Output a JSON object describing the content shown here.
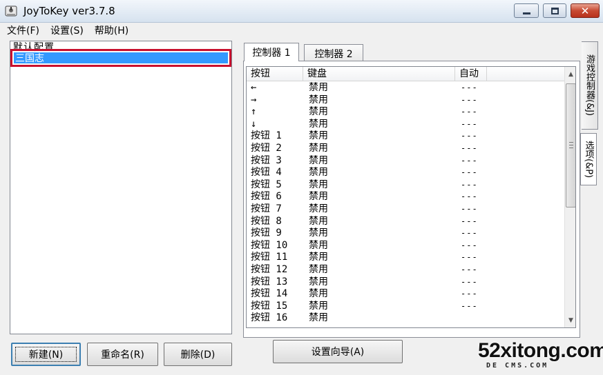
{
  "window": {
    "title": "JoyToKey ver3.7.8",
    "min_icon": "minimize-icon",
    "max_icon": "maximize-icon",
    "close_icon": "close-icon",
    "close_glyph": "✕"
  },
  "menu": {
    "file": "文件(F)",
    "settings": "设置(S)",
    "help": "帮助(H)"
  },
  "profiles": {
    "items": [
      "默认配置",
      "三国志"
    ],
    "selected": "三国志",
    "highlight_color": "#3399ff",
    "annotation_color": "#c8102e"
  },
  "buttons": {
    "new": "新建(N)",
    "rename": "重命名(R)",
    "delete": "删除(D)",
    "wizard": "设置向导(A)"
  },
  "tabs": {
    "controller1": "控制器 1",
    "controller2": "控制器 2"
  },
  "side_tabs": {
    "game_controller": "游戏控制器(&J)",
    "options": "选项(&P)"
  },
  "table": {
    "headers": [
      "按钮",
      "键盘",
      "自动"
    ],
    "rows": [
      {
        "button": "←",
        "icon": "arrow-left-icon",
        "key": "禁用",
        "auto": "---"
      },
      {
        "button": "→",
        "icon": "arrow-right-icon",
        "key": "禁用",
        "auto": "---"
      },
      {
        "button": "↑",
        "icon": "arrow-up-icon",
        "key": "禁用",
        "auto": "---"
      },
      {
        "button": "↓",
        "icon": "arrow-down-icon",
        "key": "禁用",
        "auto": "---"
      },
      {
        "button": "按钮 1",
        "key": "禁用",
        "auto": "---"
      },
      {
        "button": "按钮 2",
        "key": "禁用",
        "auto": "---"
      },
      {
        "button": "按钮 3",
        "key": "禁用",
        "auto": "---"
      },
      {
        "button": "按钮 4",
        "key": "禁用",
        "auto": "---"
      },
      {
        "button": "按钮 5",
        "key": "禁用",
        "auto": "---"
      },
      {
        "button": "按钮 6",
        "key": "禁用",
        "auto": "---"
      },
      {
        "button": "按钮 7",
        "key": "禁用",
        "auto": "---"
      },
      {
        "button": "按钮 8",
        "key": "禁用",
        "auto": "---"
      },
      {
        "button": "按钮 9",
        "key": "禁用",
        "auto": "---"
      },
      {
        "button": "按钮 10",
        "key": "禁用",
        "auto": "---"
      },
      {
        "button": "按钮 11",
        "key": "禁用",
        "auto": "---"
      },
      {
        "button": "按钮 12",
        "key": "禁用",
        "auto": "---"
      },
      {
        "button": "按钮 13",
        "key": "禁用",
        "auto": "---"
      },
      {
        "button": "按钮 14",
        "key": "禁用",
        "auto": "---"
      },
      {
        "button": "按钮 15",
        "key": "禁用",
        "auto": "---"
      },
      {
        "button": "按钮 16",
        "key": "禁用",
        "auto": ""
      }
    ]
  },
  "watermark": {
    "main": "52xitong.com",
    "sub": "DE CMS.COM"
  }
}
